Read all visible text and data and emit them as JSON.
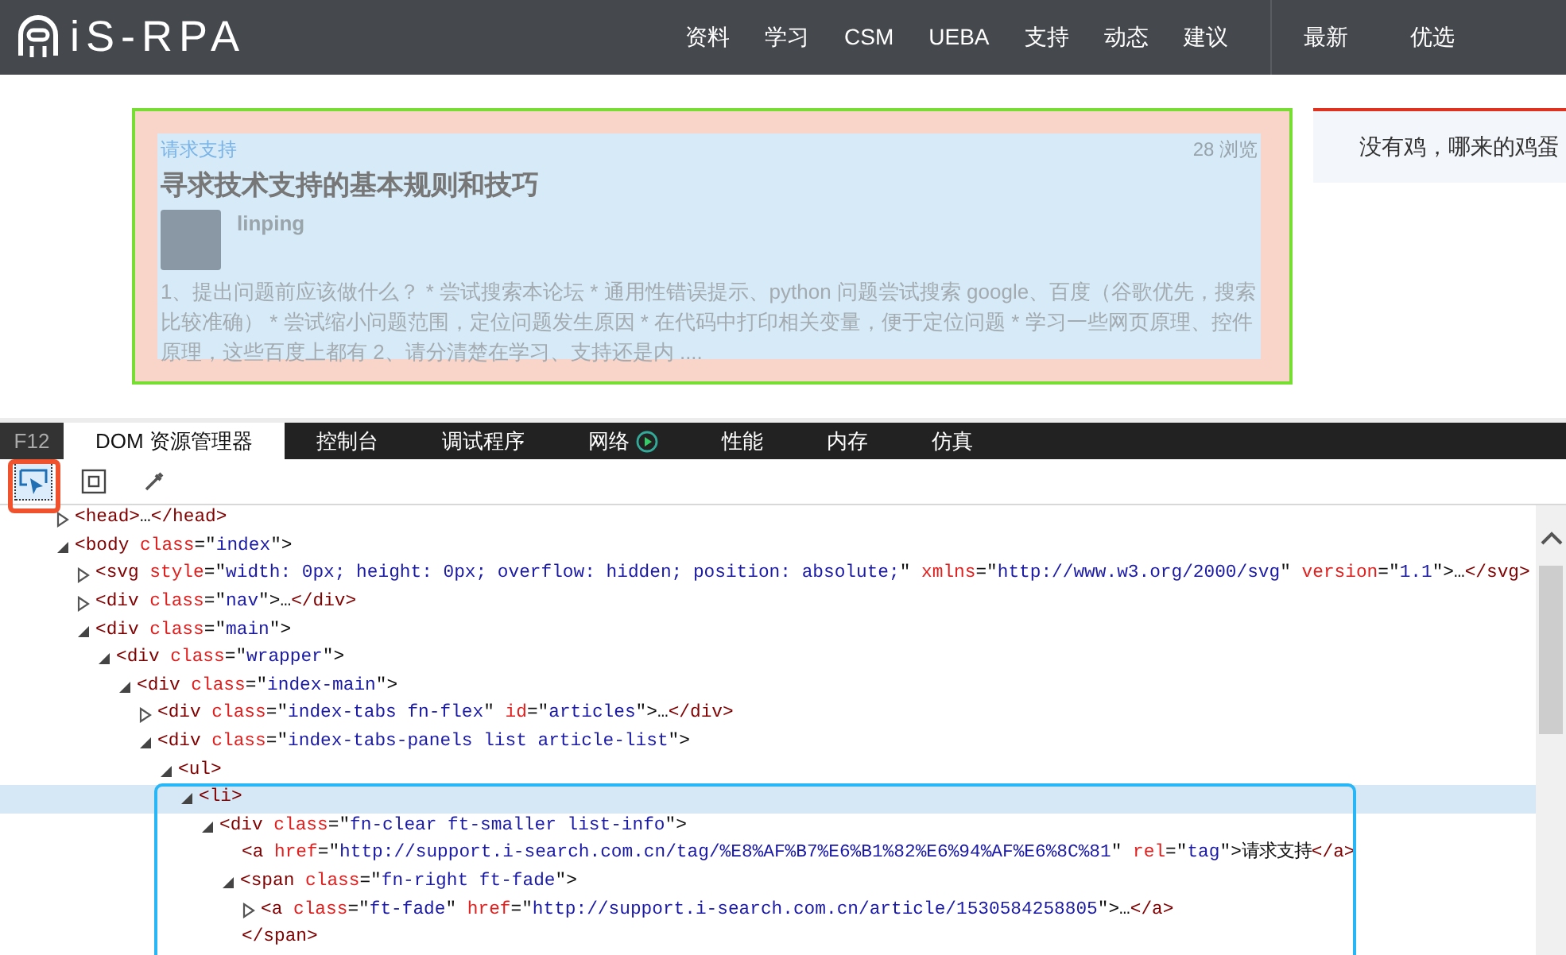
{
  "nav": {
    "logo": "iS-RPA",
    "items": [
      "资料",
      "学习",
      "CSM",
      "UEBA",
      "支持",
      "动态",
      "建议"
    ],
    "side_tabs": [
      "最新",
      "优选"
    ]
  },
  "article": {
    "tag": "请求支持",
    "views": "28 浏览",
    "title": "寻求技术支持的基本规则和技巧",
    "author": "linping",
    "excerpt": "1、提出问题前应该做什么？ * 尝试搜索本论坛 * 通用性错误提示、python 问题尝试搜索 google、百度（谷歌优先，搜索比较准确） * 尝试缩小问题范围，定位问题发生原因 * 在代码中打印相关变量，便于定位问题 * 学习一些网页原理、控件原理，这些百度上都有 2、请分清楚在学习、支持还是内 ...."
  },
  "side_panel": {
    "text": "没有鸡，哪来的鸡蛋"
  },
  "devtools": {
    "label": "F12",
    "tabs": [
      {
        "label": "DOM 资源管理器",
        "selected": true,
        "kind": "plain"
      },
      {
        "label": "控制台",
        "selected": false,
        "kind": "plain"
      },
      {
        "label": "调试程序",
        "selected": false,
        "kind": "plain"
      },
      {
        "label": "网络",
        "selected": false,
        "kind": "record"
      },
      {
        "label": "性能",
        "selected": false,
        "kind": "plain"
      },
      {
        "label": "内存",
        "selected": false,
        "kind": "plain"
      },
      {
        "label": "仿真",
        "selected": false,
        "kind": "plain"
      }
    ],
    "tools": [
      {
        "kind": "select",
        "selected": true
      },
      {
        "kind": "box",
        "selected": false
      },
      {
        "kind": "picker",
        "selected": false
      }
    ],
    "tree": [
      {
        "selected": false,
        "expanded": false,
        "tokens": [
          {
            "kind": "tag",
            "text": "<head>"
          },
          {
            "kind": "plain",
            "text": "…"
          },
          {
            "kind": "tag",
            "text": "</head>"
          }
        ]
      },
      {
        "selected": false,
        "expanded": true,
        "tokens": [
          {
            "kind": "tag",
            "text": "<body"
          },
          {
            "kind": "attr",
            "text": " class"
          },
          {
            "kind": "plain",
            "text": "=\""
          },
          {
            "kind": "value",
            "text": "index"
          },
          {
            "kind": "plain",
            "text": "\">"
          }
        ],
        "children": [
          {
            "selected": false,
            "expanded": false,
            "tokens": [
              {
                "kind": "tag",
                "text": "<svg"
              },
              {
                "kind": "attr",
                "text": " style"
              },
              {
                "kind": "plain",
                "text": "=\""
              },
              {
                "kind": "value",
                "text": "width: 0px; height: 0px; overflow: hidden; position: absolute;"
              },
              {
                "kind": "plain",
                "text": "\""
              },
              {
                "kind": "attr",
                "text": " xmlns"
              },
              {
                "kind": "plain",
                "text": "=\""
              },
              {
                "kind": "value",
                "text": "http://www.w3.org/2000/svg"
              },
              {
                "kind": "plain",
                "text": "\""
              },
              {
                "kind": "attr",
                "text": " version"
              },
              {
                "kind": "plain",
                "text": "=\""
              },
              {
                "kind": "value",
                "text": "1.1"
              },
              {
                "kind": "plain",
                "text": "\">…"
              },
              {
                "kind": "tag",
                "text": "</svg>"
              }
            ]
          },
          {
            "selected": false,
            "expanded": false,
            "tokens": [
              {
                "kind": "tag",
                "text": "<div"
              },
              {
                "kind": "attr",
                "text": " class"
              },
              {
                "kind": "plain",
                "text": "=\""
              },
              {
                "kind": "value",
                "text": "nav"
              },
              {
                "kind": "plain",
                "text": "\">…"
              },
              {
                "kind": "tag",
                "text": "</div>"
              }
            ]
          },
          {
            "selected": false,
            "expanded": true,
            "tokens": [
              {
                "kind": "tag",
                "text": "<div"
              },
              {
                "kind": "attr",
                "text": " class"
              },
              {
                "kind": "plain",
                "text": "=\""
              },
              {
                "kind": "value",
                "text": "main"
              },
              {
                "kind": "plain",
                "text": "\">"
              }
            ],
            "children": [
              {
                "selected": false,
                "expanded": true,
                "tokens": [
                  {
                    "kind": "tag",
                    "text": "<div"
                  },
                  {
                    "kind": "attr",
                    "text": " class"
                  },
                  {
                    "kind": "plain",
                    "text": "=\""
                  },
                  {
                    "kind": "value",
                    "text": "wrapper"
                  },
                  {
                    "kind": "plain",
                    "text": "\">"
                  }
                ],
                "children": [
                  {
                    "selected": false,
                    "expanded": true,
                    "tokens": [
                      {
                        "kind": "tag",
                        "text": "<div"
                      },
                      {
                        "kind": "attr",
                        "text": " class"
                      },
                      {
                        "kind": "plain",
                        "text": "=\""
                      },
                      {
                        "kind": "value",
                        "text": "index-main"
                      },
                      {
                        "kind": "plain",
                        "text": "\">"
                      }
                    ],
                    "children": [
                      {
                        "selected": false,
                        "expanded": false,
                        "tokens": [
                          {
                            "kind": "tag",
                            "text": "<div"
                          },
                          {
                            "kind": "attr",
                            "text": " class"
                          },
                          {
                            "kind": "plain",
                            "text": "=\""
                          },
                          {
                            "kind": "value",
                            "text": "index-tabs fn-flex"
                          },
                          {
                            "kind": "plain",
                            "text": "\""
                          },
                          {
                            "kind": "attr",
                            "text": " id"
                          },
                          {
                            "kind": "plain",
                            "text": "=\""
                          },
                          {
                            "kind": "value",
                            "text": "articles"
                          },
                          {
                            "kind": "plain",
                            "text": "\">…"
                          },
                          {
                            "kind": "tag",
                            "text": "</div>"
                          }
                        ]
                      },
                      {
                        "selected": false,
                        "expanded": true,
                        "tokens": [
                          {
                            "kind": "tag",
                            "text": "<div"
                          },
                          {
                            "kind": "attr",
                            "text": " class"
                          },
                          {
                            "kind": "plain",
                            "text": "=\""
                          },
                          {
                            "kind": "value",
                            "text": "index-tabs-panels list article-list"
                          },
                          {
                            "kind": "plain",
                            "text": "\">"
                          }
                        ],
                        "children": [
                          {
                            "selected": false,
                            "expanded": true,
                            "tokens": [
                              {
                                "kind": "tag",
                                "text": "<ul>"
                              }
                            ],
                            "children": [
                              {
                                "selected": true,
                                "expanded": true,
                                "tokens": [
                                  {
                                    "kind": "tag",
                                    "text": "<li>"
                                  }
                                ],
                                "children": [
                                  {
                                    "selected": false,
                                    "expanded": true,
                                    "tokens": [
                                      {
                                        "kind": "tag",
                                        "text": "<div"
                                      },
                                      {
                                        "kind": "attr",
                                        "text": " class"
                                      },
                                      {
                                        "kind": "plain",
                                        "text": "=\""
                                      },
                                      {
                                        "kind": "value",
                                        "text": "fn-clear ft-smaller list-info"
                                      },
                                      {
                                        "kind": "plain",
                                        "text": "\">"
                                      }
                                    ],
                                    "children": [
                                      {
                                        "selected": false,
                                        "tokens": [
                                          {
                                            "kind": "tag",
                                            "text": "<a"
                                          },
                                          {
                                            "kind": "attr",
                                            "text": " href"
                                          },
                                          {
                                            "kind": "plain",
                                            "text": "=\""
                                          },
                                          {
                                            "kind": "value",
                                            "text": "http://support.i-search.com.cn/tag/%E8%AF%B7%E6%B1%82%E6%94%AF%E6%8C%81"
                                          },
                                          {
                                            "kind": "plain",
                                            "text": "\""
                                          },
                                          {
                                            "kind": "attr",
                                            "text": " rel"
                                          },
                                          {
                                            "kind": "plain",
                                            "text": "=\""
                                          },
                                          {
                                            "kind": "value",
                                            "text": "tag"
                                          },
                                          {
                                            "kind": "plain",
                                            "text": "\">请求支持"
                                          },
                                          {
                                            "kind": "tag",
                                            "text": "</a>"
                                          }
                                        ]
                                      },
                                      {
                                        "selected": false,
                                        "expanded": true,
                                        "tokens": [
                                          {
                                            "kind": "tag",
                                            "text": "<span"
                                          },
                                          {
                                            "kind": "attr",
                                            "text": " class"
                                          },
                                          {
                                            "kind": "plain",
                                            "text": "=\""
                                          },
                                          {
                                            "kind": "value",
                                            "text": "fn-right ft-fade"
                                          },
                                          {
                                            "kind": "plain",
                                            "text": "\">"
                                          }
                                        ],
                                        "close": [
                                          {
                                            "kind": "tag",
                                            "text": "</span>"
                                          }
                                        ],
                                        "children": [
                                          {
                                            "selected": false,
                                            "expanded": false,
                                            "tokens": [
                                              {
                                                "kind": "tag",
                                                "text": "<a"
                                              },
                                              {
                                                "kind": "attr",
                                                "text": " class"
                                              },
                                              {
                                                "kind": "plain",
                                                "text": "=\""
                                              },
                                              {
                                                "kind": "value",
                                                "text": "ft-fade"
                                              },
                                              {
                                                "kind": "plain",
                                                "text": "\""
                                              },
                                              {
                                                "kind": "attr",
                                                "text": " href"
                                              },
                                              {
                                                "kind": "plain",
                                                "text": "=\""
                                              },
                                              {
                                                "kind": "value",
                                                "text": "http://support.i-search.com.cn/article/1530584258805"
                                              },
                                              {
                                                "kind": "plain",
                                                "text": "\">…"
                                              },
                                              {
                                                "kind": "tag",
                                                "text": "</a>"
                                              }
                                            ]
                                          }
                                        ]
                                      }
                                    ]
                                  }
                                ]
                              }
                            ]
                          }
                        ]
                      }
                    ]
                  }
                ]
              }
            ]
          }
        ]
      }
    ]
  }
}
